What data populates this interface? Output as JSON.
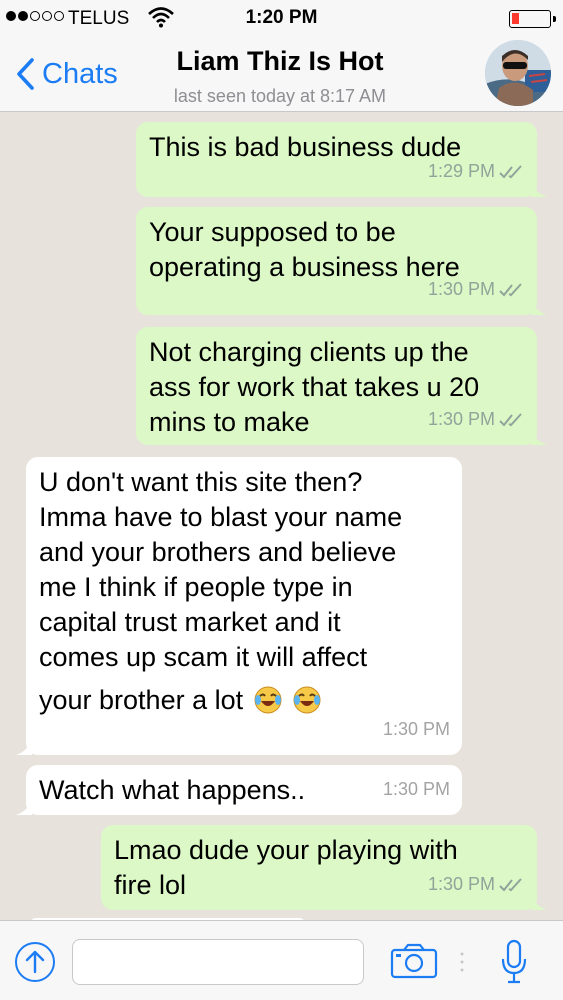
{
  "status_bar": {
    "carrier": "TELUS",
    "time": "1:20 PM",
    "signal_bars_filled": 2,
    "signal_bars_total": 5,
    "battery_level": 0.1
  },
  "header": {
    "back_label": "Chats",
    "contact_name": "Liam Thiz Is Hot",
    "last_seen": "last seen today at 8:17 AM",
    "avatar_icon": "contact-avatar-photo"
  },
  "messages": [
    {
      "direction": "out",
      "lines": [
        "This is bad business dude"
      ],
      "time": "1:29 PM",
      "status": "read-double-check"
    },
    {
      "direction": "out",
      "lines": [
        "Your supposed to be",
        "operating a business here"
      ],
      "time": "1:30 PM",
      "status": "read-double-check"
    },
    {
      "direction": "out",
      "lines": [
        "Not charging clients up the",
        "ass for work that takes u 20",
        "mins to make"
      ],
      "time": "1:30 PM",
      "status": "read-double-check"
    },
    {
      "direction": "in",
      "lines": [
        "U don't want this site then?",
        "Imma have to blast your name",
        "and your brothers and believe",
        "me I think if people type in",
        "capital trust market and it",
        "comes up scam it will affect",
        "your brother a lot"
      ],
      "emoji": "😂😂",
      "time": "1:30 PM"
    },
    {
      "direction": "in",
      "lines": [
        "Watch what happens.."
      ],
      "time": "1:30 PM"
    },
    {
      "direction": "out",
      "lines": [
        "Lmao dude your playing with",
        "fire lol"
      ],
      "time": "1:30 PM",
      "status": "read-double-check"
    }
  ],
  "input_bar": {
    "attach_icon": "share-arrow-icon",
    "message_placeholder": "",
    "camera_icon": "camera-icon",
    "mic_icon": "microphone-icon"
  },
  "colors": {
    "outgoing_bubble": "#dcf8c6",
    "incoming_bubble": "#ffffff",
    "background": "#e7e3dc",
    "accent": "#1c7cf4",
    "battery_low": "#ff3b30"
  }
}
